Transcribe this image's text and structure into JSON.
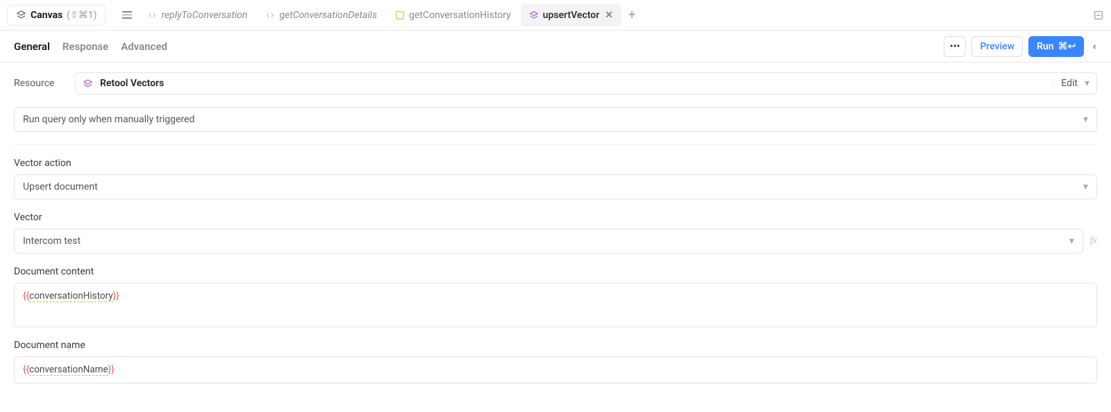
{
  "topbar": {
    "canvas_label": "Canvas",
    "canvas_shortcut": "(⇧⌘1)",
    "tabs": [
      {
        "label": "replyToConversation",
        "kind": "code",
        "active": false
      },
      {
        "label": "getConversationDetails",
        "kind": "code",
        "active": false
      },
      {
        "label": "getConversationHistory",
        "kind": "js",
        "active": false
      },
      {
        "label": "upsertVector",
        "kind": "vec",
        "active": true
      }
    ]
  },
  "subtabs": {
    "general": "General",
    "response": "Response",
    "advanced": "Advanced"
  },
  "actions": {
    "more": "•••",
    "preview": "Preview",
    "run": "Run",
    "run_shortcut": "⌘↩"
  },
  "resource": {
    "label": "Resource",
    "name": "Retool Vectors",
    "edit": "Edit"
  },
  "trigger": {
    "value": "Run query only when manually triggered"
  },
  "fields": {
    "vector_action": {
      "label": "Vector action",
      "value": "Upsert document"
    },
    "vector": {
      "label": "Vector",
      "value": "Intercom test"
    },
    "doc_content": {
      "label": "Document content",
      "value": "conversationHistory",
      "open": "{{",
      "close": "}}"
    },
    "doc_name": {
      "label": "Document name",
      "value": "conversationName",
      "open": "{{",
      "close": "}}"
    }
  },
  "fx": "fx"
}
